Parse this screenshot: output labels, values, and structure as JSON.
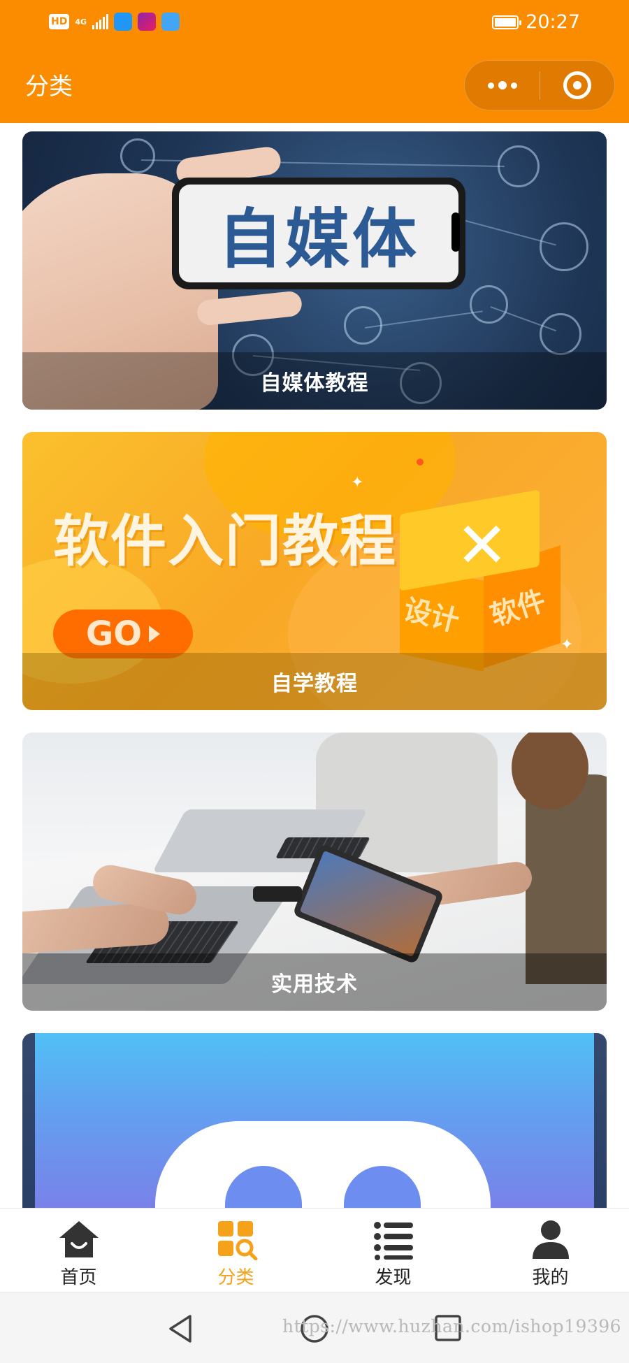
{
  "status_bar": {
    "hd_badge": "HD",
    "network": "4G",
    "time": "20:27",
    "battery_level": 1.0,
    "accent": "#fb8c00"
  },
  "nav": {
    "title": "分类",
    "capsule_more_icon": "more-dots-icon",
    "capsule_close_icon": "target-close-icon"
  },
  "categories": [
    {
      "label": "自媒体教程",
      "banner_text": "自媒体"
    },
    {
      "label": "自学教程",
      "banner_text": "软件入门教程",
      "button_text": "GO",
      "box_text_1": "设计",
      "box_text_2": "软件"
    },
    {
      "label": "实用技术"
    },
    {
      "label": ""
    }
  ],
  "tabbar": {
    "items": [
      {
        "label": "首页",
        "icon": "home-icon",
        "active": false
      },
      {
        "label": "分类",
        "icon": "category-icon",
        "active": true
      },
      {
        "label": "发现",
        "icon": "list-icon",
        "active": false
      },
      {
        "label": "我的",
        "icon": "user-icon",
        "active": false
      }
    ],
    "active_color": "#f5a11a",
    "inactive_color": "#333333"
  },
  "system_nav": {
    "watermark": "https://www.huzhan.com/ishop19396"
  }
}
